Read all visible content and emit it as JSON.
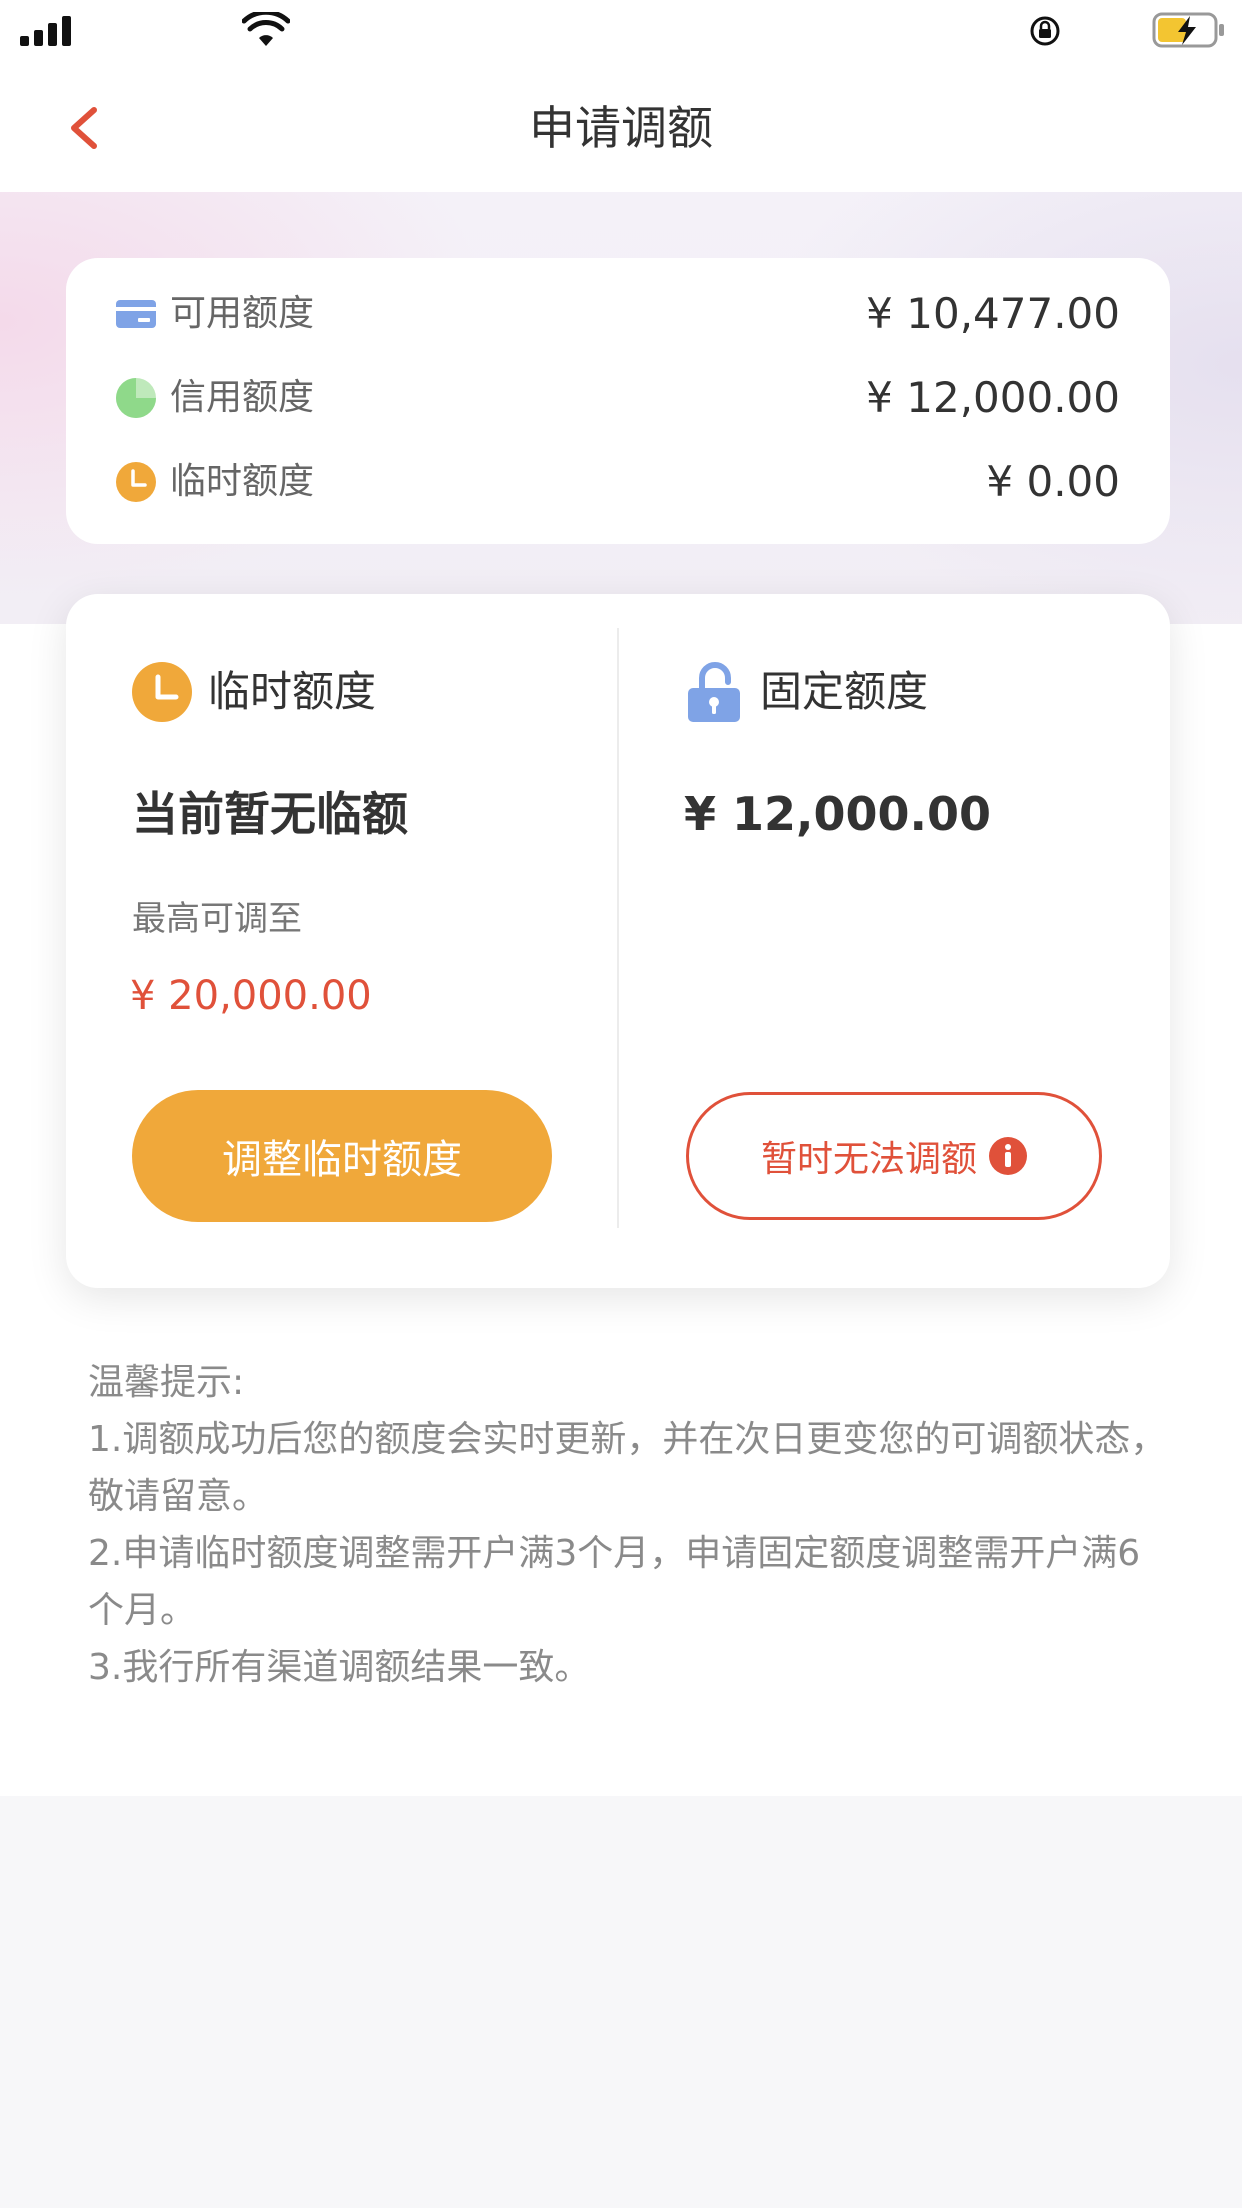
{
  "page": {
    "title": "申请调额"
  },
  "icons": {
    "back": "chevron-left-icon",
    "card": "card-icon",
    "pie": "pie-icon",
    "clock": "clock-icon",
    "lock": "lock-icon",
    "info": "info-icon"
  },
  "colors": {
    "accent_orange": "#f0a83a",
    "accent_red": "#e0513a",
    "card_blue": "#7fa3e6",
    "pie_green": "#8fd98a"
  },
  "summary": {
    "available": {
      "label": "可用额度",
      "value": "¥ 10,477.00"
    },
    "credit": {
      "label": "信用额度",
      "value": "¥ 12,000.00"
    },
    "temp": {
      "label": "临时额度",
      "value": "¥ 0.00"
    }
  },
  "temp_col": {
    "title": "临时额度",
    "status": "当前暂无临额",
    "max_label": "最高可调至",
    "max_value": "¥ 20,000.00",
    "button": "调整临时额度"
  },
  "fixed_col": {
    "title": "固定额度",
    "amount": "¥ 12,000.00",
    "button": "暂时无法调额"
  },
  "tips": {
    "heading": "温馨提示:",
    "lines": [
      "1.调额成功后您的额度会实时更新，并在次日更变您的可调额状态，敬请留意。",
      "2.申请临时额度调整需开户满3个月，申请固定额度调整需开户满6个月。",
      "3.我行所有渠道调额结果一致。"
    ]
  }
}
